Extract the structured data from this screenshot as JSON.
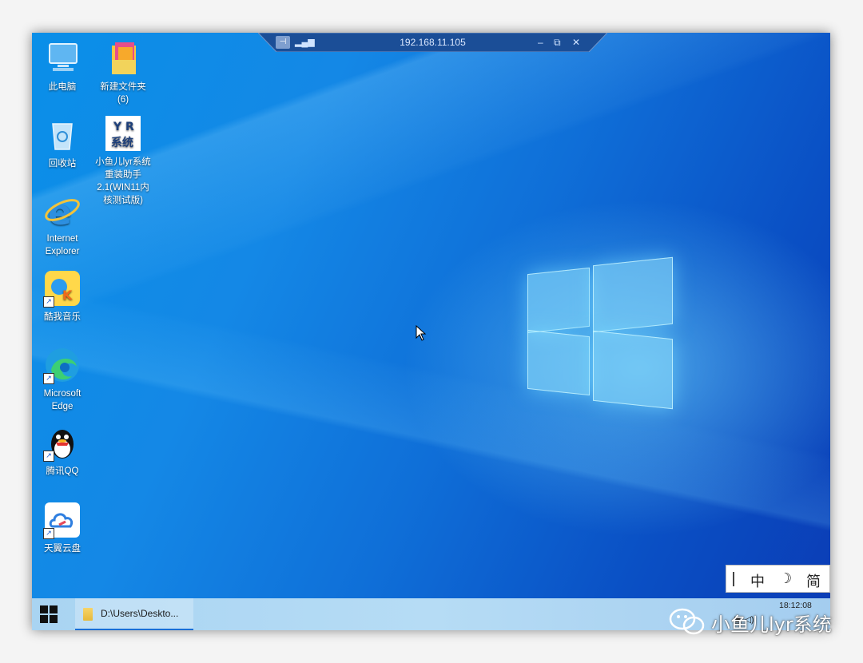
{
  "remote_bar": {
    "title": "192.168.11.105",
    "minimize_glyph": "–",
    "restore_glyph": "⧉",
    "close_glyph": "✕"
  },
  "desktop": {
    "icons": [
      {
        "label": "此电脑",
        "icon": "computer-icon"
      },
      {
        "label": "新建文件夹\n(6)",
        "icon": "folder-icon"
      },
      {
        "label": "回收站",
        "icon": "recycle-bin-icon"
      },
      {
        "label": "小鱼儿lyr系统\n重装助手\n2.1(WIN11内\n核测试版)",
        "icon": "yr-system-icon"
      },
      {
        "label": "Internet\nExplorer",
        "icon": "internet-explorer-icon"
      },
      {
        "label": "酷我音乐",
        "icon": "kuwo-music-icon"
      },
      {
        "label": "Microsoft\nEdge",
        "icon": "edge-icon"
      },
      {
        "label": "腾讯QQ",
        "icon": "qq-icon"
      },
      {
        "label": "天翼云盘",
        "icon": "tianyi-cloud-icon"
      }
    ]
  },
  "ime_bar": {
    "mode": "中",
    "moon": "☽",
    "script": "简"
  },
  "taskbar": {
    "explorer_label": "D:\\Users\\Deskto...",
    "clock": "18:12:08"
  },
  "watermark": {
    "text": "小鱼儿lyr系统"
  },
  "colors": {
    "accent": "#1a6fd6",
    "taskbar": "#b6dcf5",
    "wallpaper": "#0f6fd8"
  }
}
